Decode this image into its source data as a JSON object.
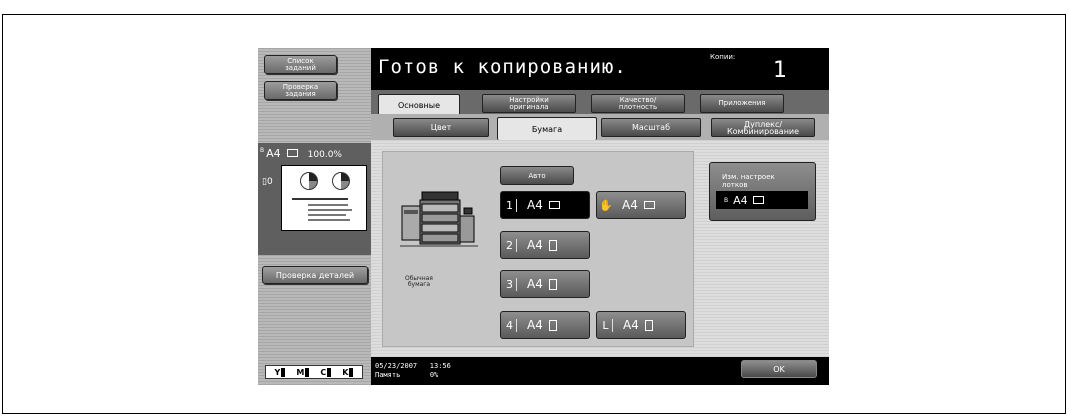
{
  "left_panel": {
    "job_list": "Список\nзаданий",
    "job_check": "Проверка\nзадания",
    "preview_size": "A4",
    "preview_size_marker": "B",
    "preview_zoom": "100.0%",
    "preview_sheet_count": "0",
    "check_details": "Проверка деталей",
    "toner": [
      "Y",
      "M",
      "C",
      "K"
    ]
  },
  "header": {
    "title": "Готов к копированию.",
    "copies_label": "Копии:",
    "copies_value": "1"
  },
  "tabs": [
    "Основные",
    "Настройки\nоригинала",
    "Качество/\nплотность",
    "Приложения"
  ],
  "subtabs": [
    "Цвет",
    "Бумага",
    "Масштаб",
    "Дуплекс/\nКомбинирование"
  ],
  "paper": {
    "auto": "Авто",
    "paper_type": "Обычная\nбумага",
    "trays": [
      {
        "num": "1",
        "size": "A4"
      },
      {
        "num": "2",
        "size": "A4"
      },
      {
        "num": "3",
        "size": "A4"
      },
      {
        "num": "4",
        "size": "A4"
      }
    ],
    "bypass_size": "A4",
    "lct": {
      "num": "L",
      "size": "A4"
    },
    "tray_settings_label": "Изм. настроек\nлотков",
    "tray_settings_value": "A4",
    "tray_settings_marker": "B"
  },
  "footer": {
    "datetime": "05/23/2007   13:56",
    "memory_label": "Память",
    "memory_value": "0%",
    "ok": "OK"
  },
  "colors": {
    "screen_bg": "#9a9a9a",
    "header_bg": "#000000",
    "selected_tray": "#000000"
  }
}
